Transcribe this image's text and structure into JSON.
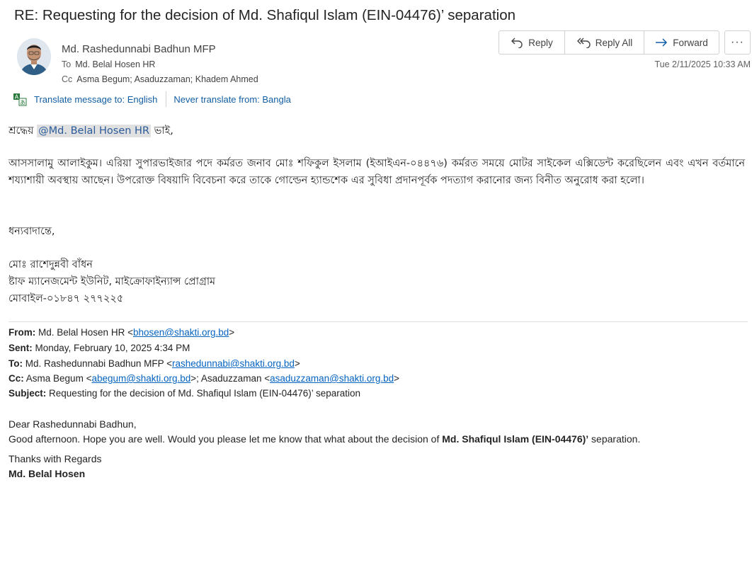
{
  "email": {
    "subject": "RE: Requesting for the decision of Md. Shafiqul Islam (EIN-04476)’ separation",
    "sender": "Md. Rashedunnabi Badhun MFP",
    "to_label": "To",
    "to": "Md. Belal  Hosen HR",
    "cc_label": "Cc",
    "cc": "Asma Begum; Asaduzzaman; Khadem Ahmed",
    "date": "Tue 2/11/2025 10:33 AM"
  },
  "actions": {
    "reply": "Reply",
    "reply_all": "Reply All",
    "forward": "Forward",
    "more": "···"
  },
  "translate": {
    "translate_to": "Translate message to: English",
    "never_translate": "Never translate from: Bangla"
  },
  "body": {
    "greeting_prefix": "শ্রদ্ধেয়",
    "mention": "@Md.  Belal   Hosen  HR",
    "greeting_suffix": "ভাই,",
    "paragraph": "আসসালামু আলাইকুম। এরিয়া সুপারভাইজার পদে কর্মরত জনাব মোঃ শফিকুল ইসলাম (ইআইএন-০৪৪৭৬) কর্মরত সময়ে মোটর সাইকেল এক্সিডেন্ট করেছিলেন এবং এখন বর্তমানে শয্যাশায়ী অবস্থায় আছেন। উপরোক্ত বিষয়াদি বিবেচনা করে তাকে গোল্ডেন হ্যান্ডশেক এর সুবিধা প্রদানপূর্বক পদত্যাগ করানোর জন্য বিনীত অনুরোধ করা হলো।",
    "closing": "ধন্যবাদান্তে,",
    "sig_name": "মোঃ রাশেদুন্নবী বাঁধন",
    "sig_title": "ষ্টাফ ম্যানেজমেন্ট ইউনিট, মাইক্রোফাইন্যান্স প্রোগ্রাম",
    "sig_mobile": "মোবাইল-০১৮৪৭ ২৭৭২২৫"
  },
  "quoted": {
    "from_label": "From:",
    "from_name": "Md. Belal Hosen HR",
    "from_email": "bhosen@shakti.org.bd",
    "sent_label": "Sent:",
    "sent": "Monday, February 10, 2025 4:34 PM",
    "to_label": "To:",
    "to_name": "Md. Rashedunnabi Badhun MFP",
    "to_email": "rashedunnabi@shakti.org.bd",
    "cc_label": "Cc:",
    "cc1_name": "Asma Begum",
    "cc1_email": "abegum@shakti.org.bd",
    "cc2_name": "Asaduzzaman",
    "cc2_email": "asaduzzaman@shakti.org.bd",
    "subject_label": "Subject:",
    "subject": "Requesting for the decision of Md. Shafiqul Islam (EIN-04476)’ separation",
    "salutation": "Dear Rashedunnabi Badhun,",
    "line_prefix": "Good afternoon. Hope you are well. Would you please let me know that what about the decision of ",
    "line_bold": "Md. Shafiqul Islam (EIN-04476)’",
    "line_suffix": " separation.",
    "thanks": "Thanks with Regards",
    "sig_name": "Md. Belal Hosen"
  },
  "colors": {
    "link": "#0563c1",
    "translate_link": "#115ea3",
    "mention_bg": "#e0e0e0",
    "mention_text": "#2b5b9a"
  }
}
